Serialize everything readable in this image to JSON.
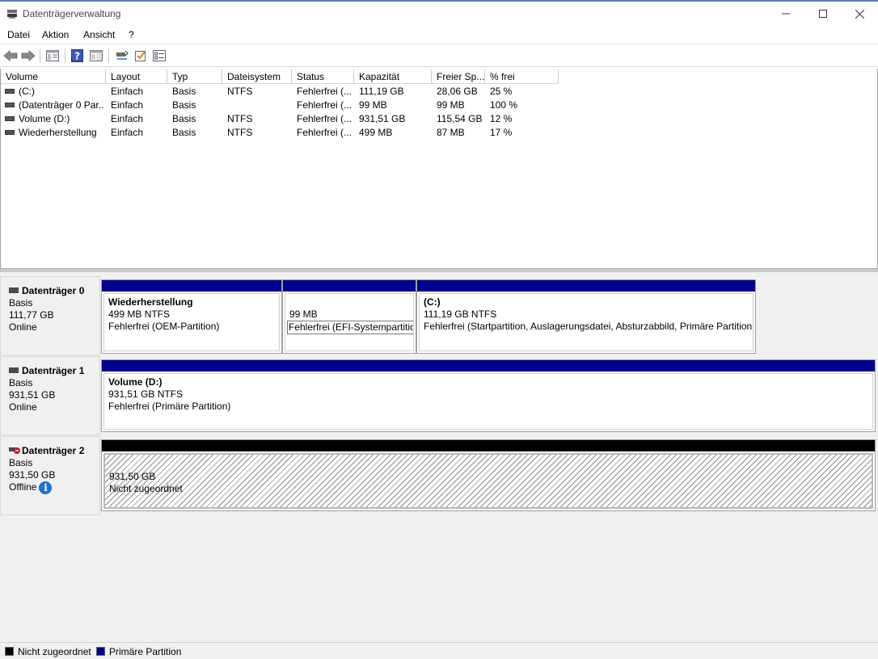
{
  "window": {
    "title": "Datenträgerverwaltung"
  },
  "menu": [
    "Datei",
    "Aktion",
    "Ansicht",
    "?"
  ],
  "toolbar": {
    "icons": [
      "back-arrow-icon",
      "forward-arrow-icon",
      "properties-icon",
      "help-icon",
      "console-view-icon",
      "connect-icon",
      "check-icon",
      "settings-list-icon"
    ]
  },
  "volume_list": {
    "columns": [
      "Volume",
      "Layout",
      "Typ",
      "Dateisystem",
      "Status",
      "Kapazität",
      "Freier Sp...",
      "% frei"
    ],
    "rows": [
      [
        "(C:)",
        "Einfach",
        "Basis",
        "NTFS",
        "Fehlerfrei (...",
        "111,19 GB",
        "28,06 GB",
        "25 %"
      ],
      [
        "(Datenträger 0 Par...",
        "Einfach",
        "Basis",
        "",
        "Fehlerfrei (...",
        "99 MB",
        "99 MB",
        "100 %"
      ],
      [
        "Volume (D:)",
        "Einfach",
        "Basis",
        "NTFS",
        "Fehlerfrei (...",
        "931,51 GB",
        "115,54 GB",
        "12 %"
      ],
      [
        "Wiederherstellung",
        "Einfach",
        "Basis",
        "NTFS",
        "Fehlerfrei (...",
        "499 MB",
        "87 MB",
        "17 %"
      ]
    ]
  },
  "disks": [
    {
      "name": "Datenträger 0",
      "type": "Basis",
      "size": "111,77 GB",
      "state": "Online",
      "partitions": [
        {
          "name": "Wiederherstellung",
          "size": "499 MB NTFS",
          "status": "Fehlerfrei (OEM-Partition)"
        },
        {
          "name": "",
          "size": "99 MB",
          "status": "Fehlerfrei (EFI-Systempartition)"
        },
        {
          "name": "(C:)",
          "size": "111,19 GB NTFS",
          "status": "Fehlerfrei (Startpartition, Auslagerungsdatei, Absturzabbild, Primäre Partition)"
        }
      ]
    },
    {
      "name": "Datenträger 1",
      "type": "Basis",
      "size": "931,51 GB",
      "state": "Online",
      "partitions": [
        {
          "name": "Volume  (D:)",
          "size": "931,51 GB NTFS",
          "status": "Fehlerfrei (Primäre Partition)"
        }
      ]
    },
    {
      "name": "Datenträger 2",
      "type": "Basis",
      "size": "931,50 GB",
      "state": "Offline",
      "partitions": [
        {
          "size": "931,50 GB",
          "status": "Nicht zugeordnet"
        }
      ]
    }
  ],
  "legend": {
    "unallocated": {
      "label": "Nicht zugeordnet",
      "color": "#000000"
    },
    "primary": {
      "label": "Primäre Partition",
      "color": "#00008b"
    }
  },
  "colors": {
    "primary_bar": "#00008b",
    "unallocated_bar": "#000000",
    "info": "#1e70d0"
  }
}
